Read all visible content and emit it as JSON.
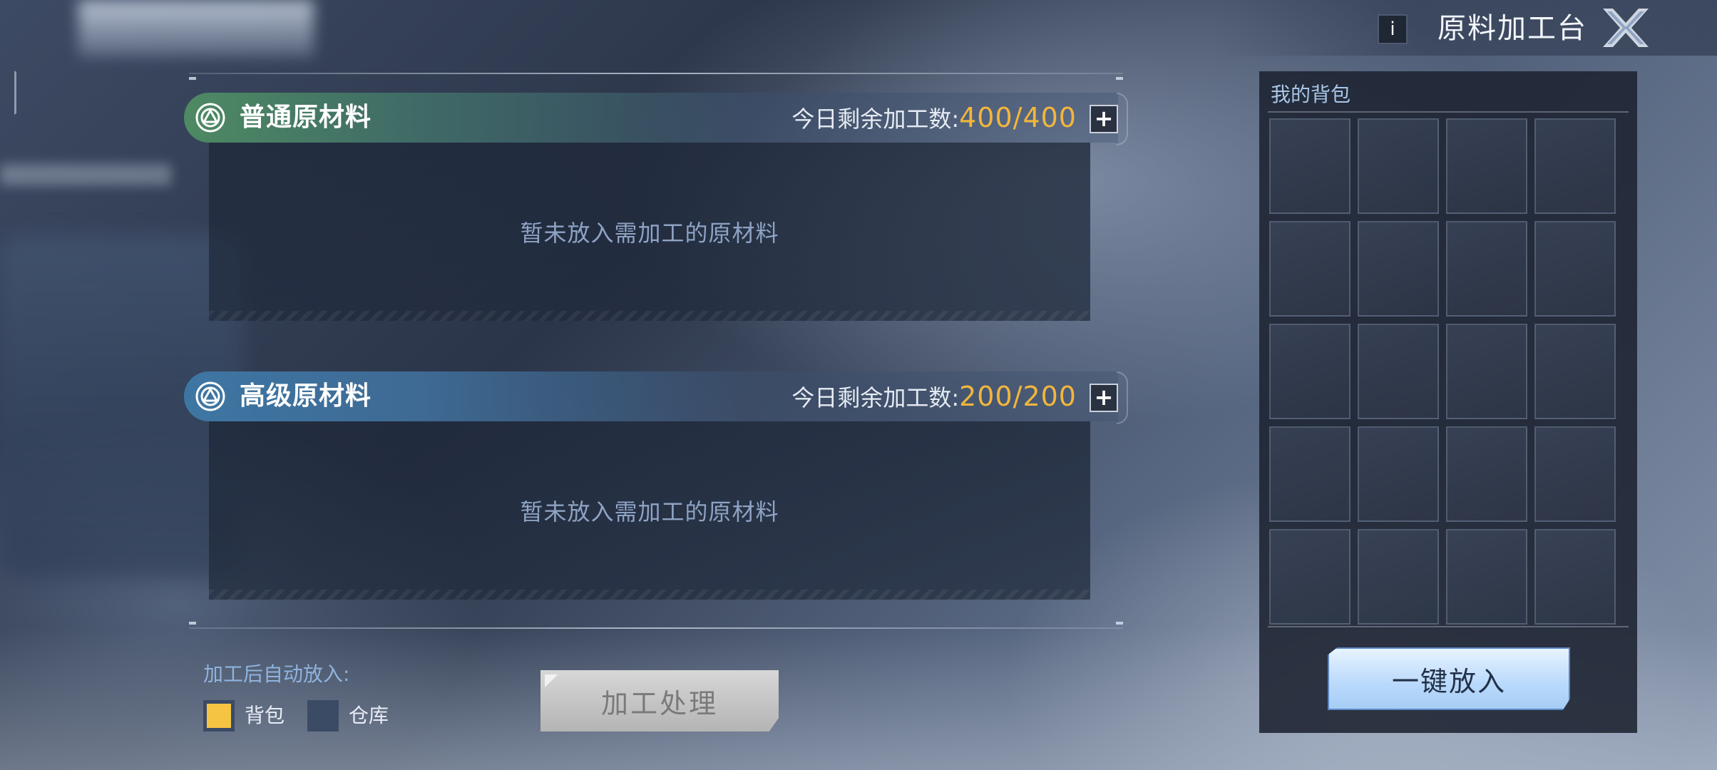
{
  "header": {
    "info_label": "i",
    "title": "原料加工台"
  },
  "sections": {
    "normal": {
      "title": "普通原材料",
      "remaining_label": "今日剩余加工数:",
      "remaining_value": "400/400",
      "plus_label": "+",
      "empty_hint": "暂未放入需加工的原材料"
    },
    "advanced": {
      "title": "高级原材料",
      "remaining_label": "今日剩余加工数:",
      "remaining_value": "200/200",
      "plus_label": "+",
      "empty_hint": "暂未放入需加工的原材料"
    }
  },
  "auto_put": {
    "label": "加工后自动放入:",
    "options": [
      {
        "label": "背包",
        "checked": true
      },
      {
        "label": "仓库",
        "checked": false
      }
    ]
  },
  "process_button": "加工处理",
  "backpack": {
    "title": "我的背包",
    "slots_visible": 20,
    "one_key_button": "一键放入"
  },
  "colors": {
    "accent_orange": "#f2b63c",
    "normal_header": "#4e8a63",
    "advanced_header": "#3e76a3",
    "checkbox_on": "#f5c443"
  }
}
